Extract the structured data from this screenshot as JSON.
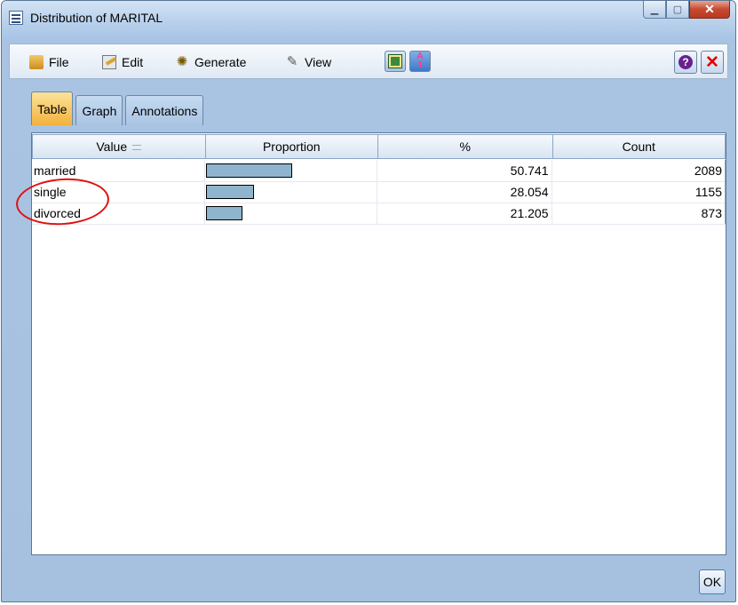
{
  "window": {
    "title": "Distribution of MARITAL"
  },
  "menubar": {
    "file": "File",
    "edit": "Edit",
    "generate": "Generate",
    "view": "View"
  },
  "toolbar": {
    "tb2_top": "A",
    "tb2_bottom": "1",
    "help_glyph": "?",
    "close_glyph": "✕"
  },
  "tabs": [
    {
      "label": "Table",
      "active": true
    },
    {
      "label": "Graph",
      "active": false
    },
    {
      "label": "Annotations",
      "active": false
    }
  ],
  "table": {
    "columns": [
      "Value",
      "Proportion",
      "%",
      "Count"
    ],
    "rows": [
      {
        "value": "married",
        "percent": "50.741",
        "count": "2089",
        "proportion": 0.50741
      },
      {
        "value": "single",
        "percent": "28.054",
        "count": "1155",
        "proportion": 0.28054
      },
      {
        "value": "divorced",
        "percent": "21.205",
        "count": "873",
        "proportion": 0.21205
      }
    ]
  },
  "footer": {
    "ok_label": "OK"
  },
  "colors": {
    "bar_fill": "#8fb4ce",
    "annotation_circle": "#e01010",
    "active_tab": "#f2b23d"
  },
  "icons": [
    "window-icon",
    "folder-icon",
    "edit-icon",
    "generate-icon",
    "view-icon",
    "insert-node-icon",
    "sort-icon",
    "help-icon",
    "close-icon"
  ]
}
